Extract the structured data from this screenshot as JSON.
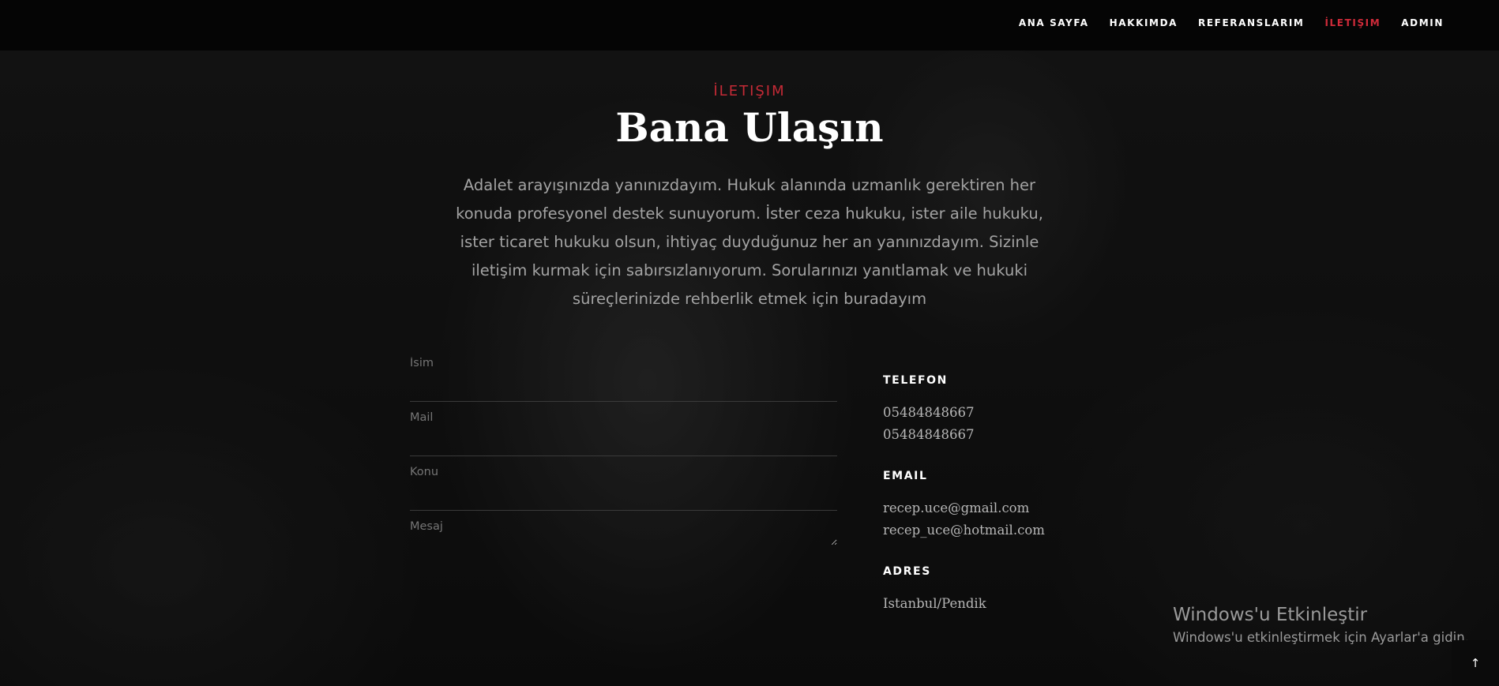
{
  "nav": {
    "items": [
      {
        "label": "ANA SAYFA",
        "active": false
      },
      {
        "label": "HAKKIMDA",
        "active": false
      },
      {
        "label": "REFERANSLARIM",
        "active": false
      },
      {
        "label": "İLETIŞIM",
        "active": true
      },
      {
        "label": "ADMIN",
        "active": false
      }
    ]
  },
  "contact": {
    "eyebrow": "İLETIŞIM",
    "title": "Bana Ulaşın",
    "intro": "Adalet arayışınızda yanınızdayım. Hukuk alanında uzmanlık gerektiren her konuda profesyonel destek sunuyorum. İster ceza hukuku, ister aile hukuku, ister ticaret hukuku olsun, ihtiyaç duyduğunuz her an yanınızdayım. Sizinle iletişim kurmak için sabırsızlanıyorum. Sorularınızı yanıtlamak ve hukuki süreçlerinizde rehberlik etmek için buradayım"
  },
  "form": {
    "name_placeholder": "İsim",
    "mail_placeholder": "Mail",
    "subject_placeholder": "Konu",
    "message_placeholder": "Mesaj"
  },
  "info": {
    "phone": {
      "heading": "TELEFON",
      "lines": [
        "05484848667",
        "05484848667"
      ]
    },
    "email": {
      "heading": "EMAIL",
      "lines": [
        "recep.uce@gmail.com",
        "recep_uce@hotmail.com"
      ]
    },
    "address": {
      "heading": "ADRES",
      "lines": [
        "Istanbul/Pendik"
      ]
    }
  },
  "watermark": {
    "title": "Windows'u Etkinleştir",
    "subtitle": "Windows'u etkinleştirmek için Ayarlar'a gidin."
  },
  "scroll_top": {
    "icon": "arrow-up-icon",
    "glyph": "↑"
  },
  "colors": {
    "accent": "#d12b3a",
    "navbar": "#050505",
    "background": "#151515"
  }
}
